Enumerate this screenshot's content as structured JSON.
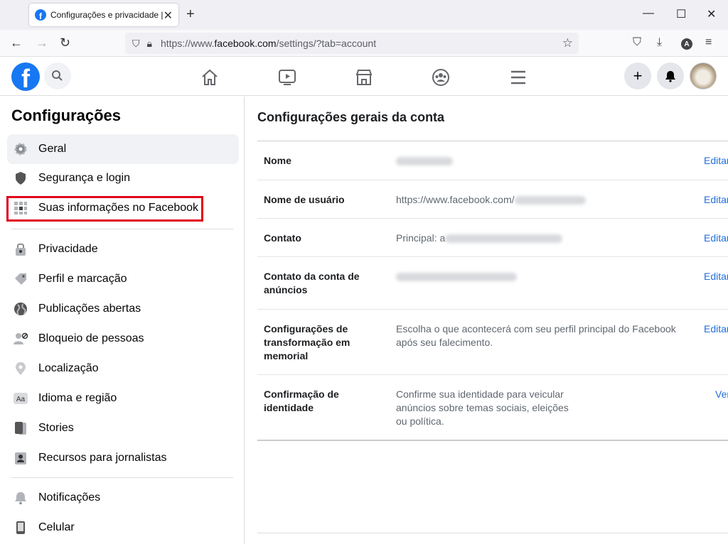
{
  "browser": {
    "tab_title": "Configurações e privacidade | Fa",
    "url_base": "https://www.",
    "url_domain": "facebook.com",
    "url_path": "/settings/?tab=account"
  },
  "colors": {
    "accent": "#1877f2",
    "link": "#216fdb",
    "highlight": "#e0001b"
  },
  "sidebar": {
    "title": "Configurações",
    "items": [
      {
        "label": "Geral",
        "icon": "gear-icon"
      },
      {
        "label": "Segurança e login",
        "icon": "shield-icon"
      },
      {
        "label": "Suas informações no Facebook",
        "icon": "grid-icon"
      },
      {
        "label": "Privacidade",
        "icon": "lock-icon"
      },
      {
        "label": "Perfil e marcação",
        "icon": "tag-icon"
      },
      {
        "label": "Publicações abertas",
        "icon": "globe-icon"
      },
      {
        "label": "Bloqueio de pessoas",
        "icon": "block-user-icon"
      },
      {
        "label": "Localização",
        "icon": "location-pin-icon"
      },
      {
        "label": "Idioma e região",
        "icon": "language-icon"
      },
      {
        "label": "Stories",
        "icon": "stories-icon"
      },
      {
        "label": "Recursos para jornalistas",
        "icon": "journalist-icon"
      },
      {
        "label": "Notificações",
        "icon": "bell-icon"
      },
      {
        "label": "Celular",
        "icon": "phone-icon"
      }
    ]
  },
  "main": {
    "title": "Configurações gerais da conta",
    "rows": [
      {
        "label": "Nome",
        "value": "",
        "action": "Editar"
      },
      {
        "label": "Nome de usuário",
        "value": "https://www.facebook.com/",
        "action": "Editar"
      },
      {
        "label": "Contato",
        "value": "Principal: a",
        "action": "Editar"
      },
      {
        "label": "Contato da conta de anúncios",
        "value": "",
        "action": "Editar"
      },
      {
        "label": "Configurações de transformação em memorial",
        "value": "Escolha o que acontecerá com seu perfil principal do Facebook após seu falecimento.",
        "action": "Editar"
      },
      {
        "label": "Confirmação de identidade",
        "value": "Confirme sua identidade para veicular anúncios sobre temas sociais, eleições ou política.",
        "action": "Ver"
      }
    ]
  }
}
